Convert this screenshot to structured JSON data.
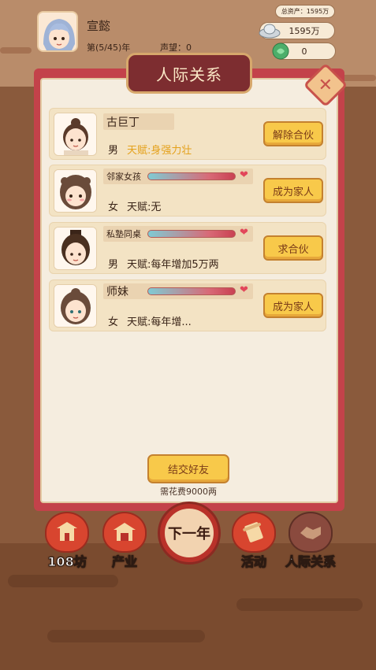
{
  "player": {
    "name": "宣懿",
    "age": "第(5/45)年",
    "fame": "声望：0"
  },
  "resources": {
    "total_assets": "总资产：1595万",
    "silver": "1595万",
    "jade": "0"
  },
  "panel": {
    "title": "人际关系"
  },
  "contacts": [
    {
      "name": "古巨丁",
      "relation": "",
      "gender": "男",
      "talent": "天赋:身强力壮",
      "action": "解除合伙"
    },
    {
      "name": "",
      "relation": "邻家女孩",
      "gender": "女",
      "talent": "天赋:无",
      "action": "成为家人"
    },
    {
      "name": "",
      "relation": "私塾同桌",
      "gender": "男",
      "talent": "天赋:每年增加5万两",
      "action": "求合伙"
    },
    {
      "name": "",
      "relation": "师妹",
      "gender": "女",
      "talent": "天赋:每年增...",
      "action": "成为家人"
    }
  ],
  "footer": {
    "make_friends": "结交好友",
    "cost": "需花费9000两"
  },
  "nav": {
    "shop": "108坊",
    "industry": "产业",
    "next_year": "下一年",
    "activity": "活动",
    "relations": "人际关系"
  },
  "colors": {
    "panel_red": "#c3424a",
    "button_gold": "#f8c94a",
    "talent_gold": "#e4a11b"
  }
}
